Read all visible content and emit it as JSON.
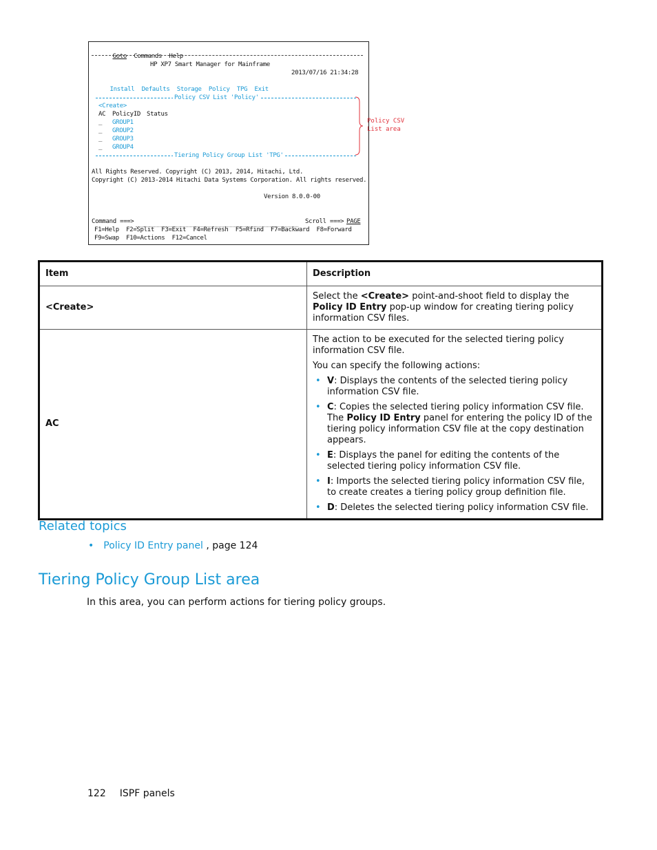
{
  "terminal": {
    "menu_bar": [
      "Goto",
      "Commands",
      "Help"
    ],
    "title": "HP XP7 Smart Manager for Mainframe",
    "datetime": "2013/07/16 21:34:28",
    "action_bar": [
      "Install",
      "Defaults",
      "Storage",
      "Policy",
      "TPG",
      "Exit"
    ],
    "policy_list_header": "Policy CSV List 'Policy'",
    "create_field": "<Create>",
    "columns": [
      "AC",
      "PolicyID",
      "Status"
    ],
    "rows": [
      {
        "ac": "_",
        "policy_id": "GROUP1",
        "status": ""
      },
      {
        "ac": "_",
        "policy_id": "GROUP2",
        "status": ""
      },
      {
        "ac": "_",
        "policy_id": "GROUP3",
        "status": ""
      },
      {
        "ac": "_",
        "policy_id": "GROUP4",
        "status": ""
      }
    ],
    "tpg_list_header": "Tiering Policy Group List 'TPG'",
    "copyright_1": "All Rights Reserved. Copyright (C) 2013, 2014, Hitachi, Ltd.",
    "copyright_2": "Copyright (C) 2013-2014 Hitachi Data Systems Corporation. All rights reserved.",
    "version": "Version 8.0.0-00",
    "command_label": "Command ===>",
    "scroll_label": "Scroll ===>",
    "scroll_value": "PAGE",
    "fkeys_line1": "F1=Help  F2=Split  F3=Exit  F4=Refresh  F5=Rfind  F7=Backward  F8=Forward",
    "fkeys_line2": "F9=Swap  F10=Actions  F12=Cancel"
  },
  "callout": {
    "line1": "Policy CSV",
    "line2": "List area",
    "color": "#e0303a"
  },
  "table": {
    "headers": [
      "Item",
      "Description"
    ],
    "create_row": {
      "item": "<Create>",
      "desc_1": "Select the ",
      "desc_2": "<Create>",
      "desc_3": " point-and-shoot field to display the ",
      "desc_4": "Policy ID Entry",
      "desc_5": " pop-up window for creating tiering policy information CSV files."
    },
    "ac_row": {
      "item": "AC",
      "intro": "The action to be executed for the selected tiering policy information CSV file.",
      "specify": "You can specify the following actions:",
      "actions": [
        {
          "key": "V",
          "text": ": Displays the contents of the selected tiering policy information CSV file."
        },
        {
          "key": "C",
          "text": ": Copies the selected tiering policy information CSV file. The ",
          "bold2": "Policy ID Entry",
          "text2": " panel for entering the policy ID of the tiering policy information CSV file at the copy destination appears."
        },
        {
          "key": "E",
          "text": ": Displays the panel for editing the contents of the selected tiering policy information CSV file."
        },
        {
          "key": "I",
          "text": ": Imports the selected tiering policy information CSV file, to create creates a tiering policy group definition file."
        },
        {
          "key": "D",
          "text": ": Deletes the selected tiering policy information CSV file."
        }
      ]
    }
  },
  "related": {
    "heading": "Related topics",
    "link": "Policy ID Entry panel",
    "suffix": " , page 124"
  },
  "section": {
    "title": "Tiering Policy Group List area",
    "body": "In this area, you can perform actions for tiering policy groups."
  },
  "footer": {
    "page": "122",
    "label": "ISPF panels"
  },
  "colors": {
    "accent": "#1a9ad6",
    "callout": "#e0303a"
  }
}
